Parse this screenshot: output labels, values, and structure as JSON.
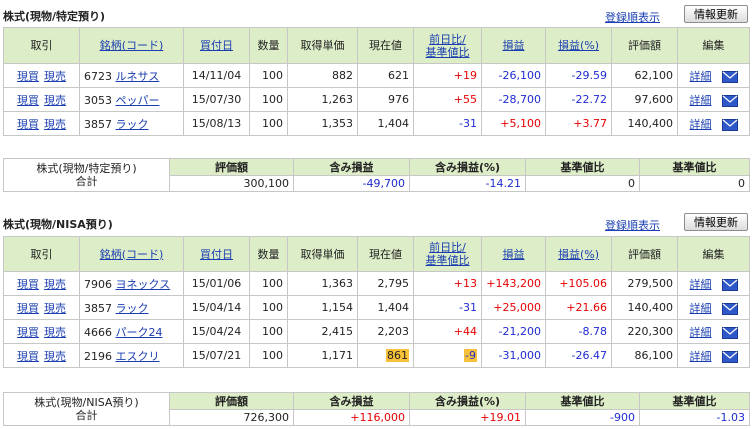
{
  "sections": [
    {
      "title": "株式(現物/特定預り)",
      "order_link": "登録順表示",
      "refresh_button": "情報更新",
      "headers": {
        "trade": "取引",
        "name": "銘柄(コード)",
        "date": "買付日",
        "qty": "数量",
        "cost": "取得単価",
        "price": "現在値",
        "change_1": "前日比/",
        "change_2": "基準値比",
        "pl": "損益",
        "plpct": "損益(%)",
        "value": "評価額",
        "edit": "編集"
      },
      "rows": [
        {
          "buy": "現買",
          "sell": "現売",
          "code": "6723",
          "name": "ルネサス",
          "date": "14/11/04",
          "qty": "100",
          "cost": "882",
          "price": "621",
          "change": "+19",
          "pl": "-26,100",
          "plpct": "-29.59",
          "value": "62,100",
          "detail": "詳細"
        },
        {
          "buy": "現買",
          "sell": "現売",
          "code": "3053",
          "name": "ペッパー",
          "date": "15/07/30",
          "qty": "100",
          "cost": "1,263",
          "price": "976",
          "change": "+55",
          "pl": "-28,700",
          "plpct": "-22.72",
          "value": "97,600",
          "detail": "詳細"
        },
        {
          "buy": "現買",
          "sell": "現売",
          "code": "3857",
          "name": "ラック",
          "date": "15/08/13",
          "qty": "100",
          "cost": "1,353",
          "price": "1,404",
          "change": "-31",
          "pl": "+5,100",
          "plpct": "+3.77",
          "value": "140,400",
          "detail": "詳細"
        }
      ],
      "summary": {
        "label_1": "株式(現物/特定預り)",
        "label_2": "合計",
        "headers": [
          "評価額",
          "含み損益",
          "含み損益(%)",
          "基準値比",
          "基準値比"
        ],
        "values": [
          "300,100",
          "-49,700",
          "-14.21",
          "0",
          "0"
        ]
      }
    },
    {
      "title": "株式(現物/NISA預り)",
      "order_link": "登録順表示",
      "refresh_button": "情報更新",
      "headers": {
        "trade": "取引",
        "name": "銘柄(コード)",
        "date": "買付日",
        "qty": "数量",
        "cost": "取得単価",
        "price": "現在値",
        "change_1": "前日比/",
        "change_2": "基準値比",
        "pl": "損益",
        "plpct": "損益(%)",
        "value": "評価額",
        "edit": "編集"
      },
      "rows": [
        {
          "buy": "現買",
          "sell": "現売",
          "code": "7906",
          "name": "ヨネックス",
          "date": "15/01/06",
          "qty": "100",
          "cost": "1,363",
          "price": "2,795",
          "change": "+13",
          "pl": "+143,200",
          "plpct": "+105.06",
          "value": "279,500",
          "detail": "詳細"
        },
        {
          "buy": "現買",
          "sell": "現売",
          "code": "3857",
          "name": "ラック",
          "date": "15/04/14",
          "qty": "100",
          "cost": "1,154",
          "price": "1,404",
          "change": "-31",
          "pl": "+25,000",
          "plpct": "+21.66",
          "value": "140,400",
          "detail": "詳細"
        },
        {
          "buy": "現買",
          "sell": "現売",
          "code": "4666",
          "name": "パーク24",
          "date": "15/04/24",
          "qty": "100",
          "cost": "2,415",
          "price": "2,203",
          "change": "+44",
          "pl": "-21,200",
          "plpct": "-8.78",
          "value": "220,300",
          "detail": "詳細"
        },
        {
          "buy": "現買",
          "sell": "現売",
          "code": "2196",
          "name": "エスクリ",
          "date": "15/07/21",
          "qty": "100",
          "cost": "1,171",
          "price": "861",
          "change": "-9",
          "pl": "-31,000",
          "plpct": "-26.47",
          "value": "86,100",
          "detail": "詳細",
          "highlight": true
        }
      ],
      "summary": {
        "label_1": "株式(現物/NISA預り)",
        "label_2": "合計",
        "headers": [
          "評価額",
          "含み損益",
          "含み損益(%)",
          "基準値比",
          "基準値比"
        ],
        "values": [
          "726,300",
          "+116,000",
          "+19.01",
          "-900",
          "-1.03"
        ]
      }
    }
  ],
  "colors": {
    "header_bg": "#ddedc8",
    "link": "#1a3fb0",
    "positive": "#e60000",
    "negative": "#1f2bd3",
    "highlight": "#f7c23a"
  },
  "icons": {
    "mail": "mail-icon"
  }
}
